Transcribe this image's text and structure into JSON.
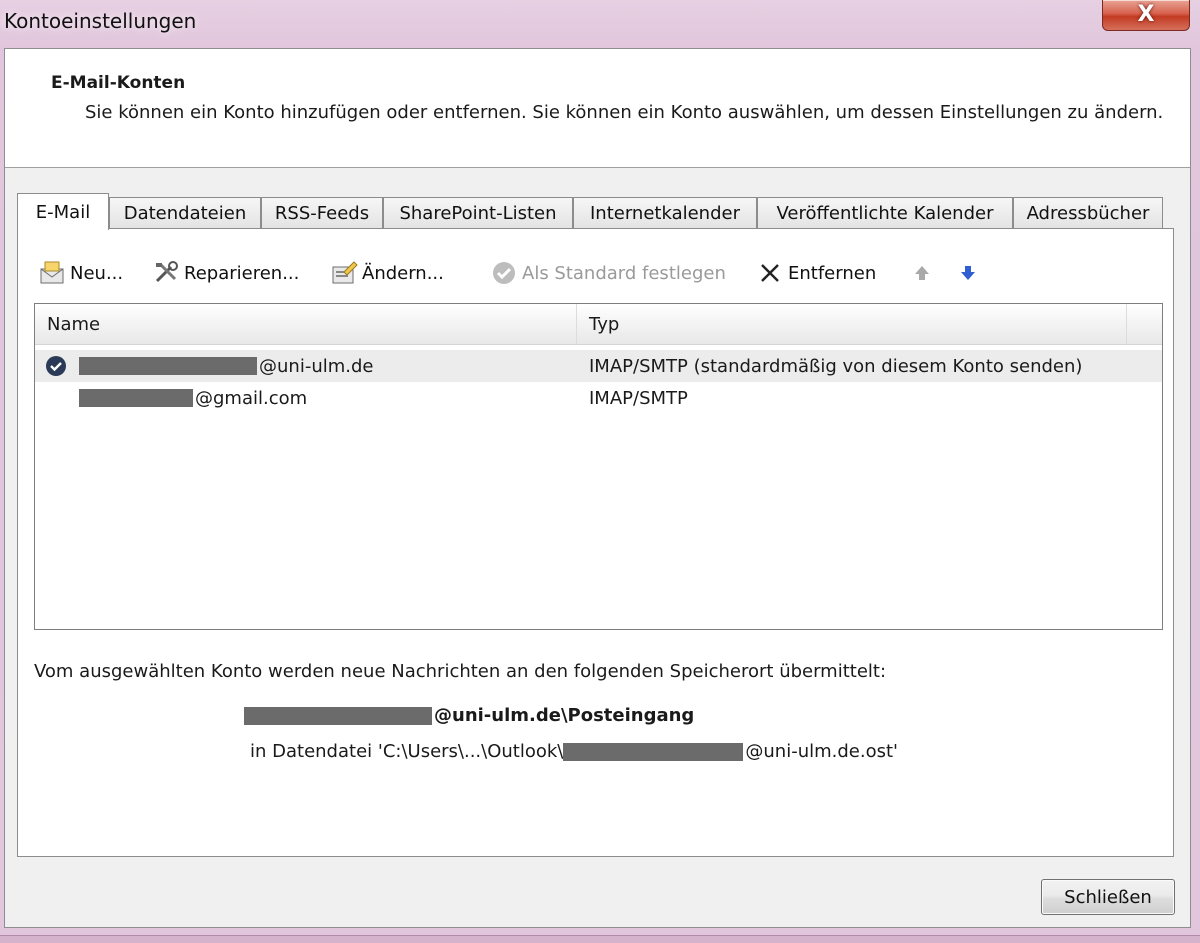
{
  "window": {
    "title": "Kontoeinstellungen",
    "close_glyph": "X"
  },
  "header": {
    "title": "E-Mail-Konten",
    "description": "Sie können ein Konto hinzufügen oder entfernen. Sie können ein Konto auswählen, um dessen Einstellungen zu ändern."
  },
  "tabs": [
    {
      "label": "E-Mail",
      "active": true
    },
    {
      "label": "Datendateien"
    },
    {
      "label": "RSS-Feeds"
    },
    {
      "label": "SharePoint-Listen"
    },
    {
      "label": "Internetkalender"
    },
    {
      "label": "Veröffentlichte Kalender"
    },
    {
      "label": "Adressbücher"
    }
  ],
  "toolbar": {
    "new_label": "Neu...",
    "repair_label": "Reparieren...",
    "change_label": "Ändern...",
    "set_default_label": "Als Standard festlegen",
    "remove_label": "Entfernen",
    "icons": [
      "new-account-icon",
      "repair-tools-icon",
      "change-account-icon",
      "default-check-icon",
      "remove-x-icon",
      "move-up-arrow-icon",
      "move-down-arrow-icon"
    ]
  },
  "accounts": {
    "columns": [
      "Name",
      "Typ"
    ],
    "rows": [
      {
        "name_suffix": "@uni-ulm.de",
        "type": "IMAP/SMTP (standardmäßig von diesem Konto senden)",
        "default": true,
        "selected": true
      },
      {
        "name_suffix": "@gmail.com",
        "type": "IMAP/SMTP",
        "default": false,
        "selected": false
      }
    ]
  },
  "delivery": {
    "label": "Vom ausgewählten Konto werden neue Nachrichten an den folgenden Speicherort übermittelt:",
    "folder_suffix": "@uni-ulm.de\\Posteingang",
    "file_prefix": "in Datendatei 'C:\\Users\\...\\Outlook\\",
    "file_suffix": "@uni-ulm.de.ost'"
  },
  "footer": {
    "close_label": "Schließen"
  },
  "colors": {
    "accent_blue": "#2f5fd0",
    "redaction": "#6b6b6b",
    "disabled_text": "#9a9a9a"
  }
}
